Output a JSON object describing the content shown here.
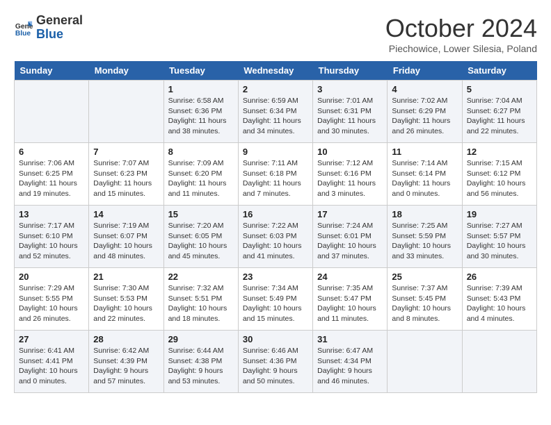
{
  "header": {
    "logo_line1": "General",
    "logo_line2": "Blue",
    "month": "October 2024",
    "location": "Piechowice, Lower Silesia, Poland"
  },
  "days_of_week": [
    "Sunday",
    "Monday",
    "Tuesday",
    "Wednesday",
    "Thursday",
    "Friday",
    "Saturday"
  ],
  "weeks": [
    [
      {
        "day": "",
        "info": ""
      },
      {
        "day": "",
        "info": ""
      },
      {
        "day": "1",
        "info": "Sunrise: 6:58 AM\nSunset: 6:36 PM\nDaylight: 11 hours and 38 minutes."
      },
      {
        "day": "2",
        "info": "Sunrise: 6:59 AM\nSunset: 6:34 PM\nDaylight: 11 hours and 34 minutes."
      },
      {
        "day": "3",
        "info": "Sunrise: 7:01 AM\nSunset: 6:31 PM\nDaylight: 11 hours and 30 minutes."
      },
      {
        "day": "4",
        "info": "Sunrise: 7:02 AM\nSunset: 6:29 PM\nDaylight: 11 hours and 26 minutes."
      },
      {
        "day": "5",
        "info": "Sunrise: 7:04 AM\nSunset: 6:27 PM\nDaylight: 11 hours and 22 minutes."
      }
    ],
    [
      {
        "day": "6",
        "info": "Sunrise: 7:06 AM\nSunset: 6:25 PM\nDaylight: 11 hours and 19 minutes."
      },
      {
        "day": "7",
        "info": "Sunrise: 7:07 AM\nSunset: 6:23 PM\nDaylight: 11 hours and 15 minutes."
      },
      {
        "day": "8",
        "info": "Sunrise: 7:09 AM\nSunset: 6:20 PM\nDaylight: 11 hours and 11 minutes."
      },
      {
        "day": "9",
        "info": "Sunrise: 7:11 AM\nSunset: 6:18 PM\nDaylight: 11 hours and 7 minutes."
      },
      {
        "day": "10",
        "info": "Sunrise: 7:12 AM\nSunset: 6:16 PM\nDaylight: 11 hours and 3 minutes."
      },
      {
        "day": "11",
        "info": "Sunrise: 7:14 AM\nSunset: 6:14 PM\nDaylight: 11 hours and 0 minutes."
      },
      {
        "day": "12",
        "info": "Sunrise: 7:15 AM\nSunset: 6:12 PM\nDaylight: 10 hours and 56 minutes."
      }
    ],
    [
      {
        "day": "13",
        "info": "Sunrise: 7:17 AM\nSunset: 6:10 PM\nDaylight: 10 hours and 52 minutes."
      },
      {
        "day": "14",
        "info": "Sunrise: 7:19 AM\nSunset: 6:07 PM\nDaylight: 10 hours and 48 minutes."
      },
      {
        "day": "15",
        "info": "Sunrise: 7:20 AM\nSunset: 6:05 PM\nDaylight: 10 hours and 45 minutes."
      },
      {
        "day": "16",
        "info": "Sunrise: 7:22 AM\nSunset: 6:03 PM\nDaylight: 10 hours and 41 minutes."
      },
      {
        "day": "17",
        "info": "Sunrise: 7:24 AM\nSunset: 6:01 PM\nDaylight: 10 hours and 37 minutes."
      },
      {
        "day": "18",
        "info": "Sunrise: 7:25 AM\nSunset: 5:59 PM\nDaylight: 10 hours and 33 minutes."
      },
      {
        "day": "19",
        "info": "Sunrise: 7:27 AM\nSunset: 5:57 PM\nDaylight: 10 hours and 30 minutes."
      }
    ],
    [
      {
        "day": "20",
        "info": "Sunrise: 7:29 AM\nSunset: 5:55 PM\nDaylight: 10 hours and 26 minutes."
      },
      {
        "day": "21",
        "info": "Sunrise: 7:30 AM\nSunset: 5:53 PM\nDaylight: 10 hours and 22 minutes."
      },
      {
        "day": "22",
        "info": "Sunrise: 7:32 AM\nSunset: 5:51 PM\nDaylight: 10 hours and 18 minutes."
      },
      {
        "day": "23",
        "info": "Sunrise: 7:34 AM\nSunset: 5:49 PM\nDaylight: 10 hours and 15 minutes."
      },
      {
        "day": "24",
        "info": "Sunrise: 7:35 AM\nSunset: 5:47 PM\nDaylight: 10 hours and 11 minutes."
      },
      {
        "day": "25",
        "info": "Sunrise: 7:37 AM\nSunset: 5:45 PM\nDaylight: 10 hours and 8 minutes."
      },
      {
        "day": "26",
        "info": "Sunrise: 7:39 AM\nSunset: 5:43 PM\nDaylight: 10 hours and 4 minutes."
      }
    ],
    [
      {
        "day": "27",
        "info": "Sunrise: 6:41 AM\nSunset: 4:41 PM\nDaylight: 10 hours and 0 minutes."
      },
      {
        "day": "28",
        "info": "Sunrise: 6:42 AM\nSunset: 4:39 PM\nDaylight: 9 hours and 57 minutes."
      },
      {
        "day": "29",
        "info": "Sunrise: 6:44 AM\nSunset: 4:38 PM\nDaylight: 9 hours and 53 minutes."
      },
      {
        "day": "30",
        "info": "Sunrise: 6:46 AM\nSunset: 4:36 PM\nDaylight: 9 hours and 50 minutes."
      },
      {
        "day": "31",
        "info": "Sunrise: 6:47 AM\nSunset: 4:34 PM\nDaylight: 9 hours and 46 minutes."
      },
      {
        "day": "",
        "info": ""
      },
      {
        "day": "",
        "info": ""
      }
    ]
  ]
}
